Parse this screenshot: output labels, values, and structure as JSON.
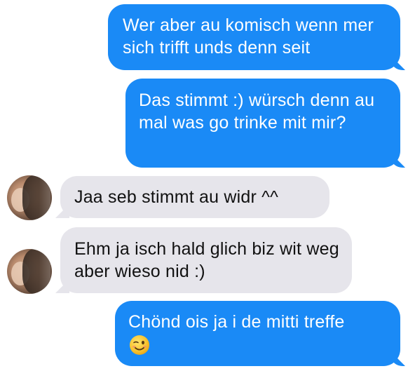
{
  "messages": [
    {
      "direction": "outgoing",
      "text": "Wer aber au komisch wenn mer sich trifft unds denn seit"
    },
    {
      "direction": "outgoing",
      "text": "Das stimmt :) würsch denn au mal was go trinke mit mir?"
    },
    {
      "direction": "incoming",
      "text": "Jaa seb stimmt au widr ^^",
      "avatar": "contact-avatar"
    },
    {
      "direction": "incoming",
      "text": "Ehm ja isch hald glich biz wit weg aber wieso nid :)",
      "avatar": "contact-avatar"
    },
    {
      "direction": "outgoing",
      "text": "Chönd ois ja i de mitti treffe",
      "emoji": "winking-face-emoji"
    }
  ],
  "colors": {
    "outgoing_bubble": "#1a8af6",
    "incoming_bubble": "#e6e5eb",
    "outgoing_text": "#ffffff",
    "incoming_text": "#111111"
  }
}
